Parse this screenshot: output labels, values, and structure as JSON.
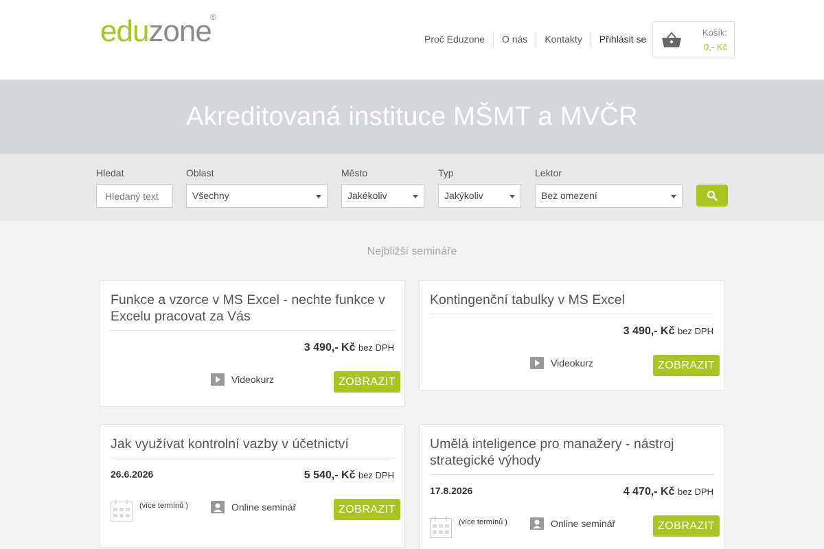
{
  "header": {
    "logo_part1": "edu",
    "logo_part2": "zone",
    "logo_reg": "®",
    "nav": [
      "Proč Eduzone",
      "O nás",
      "Kontakty",
      "Přihlásit se"
    ],
    "cart_label": "Košík:",
    "cart_price": "0,- Kč",
    "cart_icon": "basket-icon"
  },
  "banner": {
    "title": "Akreditovaná instituce MŠMT a MVČR"
  },
  "search": {
    "hledat_label": "Hledat",
    "hledat_placeholder": "Hledaný text",
    "oblast_label": "Oblast",
    "oblast_value": "Všechny",
    "mesto_label": "Město",
    "mesto_value": "Jakékoliv",
    "typ_label": "Typ",
    "typ_value": "Jakýkoliv",
    "lektor_label": "Lektor",
    "lektor_value": "Bez omezení",
    "button_icon": "search-icon"
  },
  "section_title": "Nejbližší semináře",
  "cards": [
    {
      "title": "Funkce a vzorce v MS Excel - nechte funkce v Excelu pracovat za Vás",
      "price": "3 490,- Kč",
      "vat": "bez DPH",
      "type": "Videokurz",
      "button": "ZOBRAZIT"
    },
    {
      "title": "Kontingenční tabulky v MS Excel",
      "price": "3 490,- Kč",
      "vat": "bez DPH",
      "type": "Videokurz",
      "button": "ZOBRAZIT"
    },
    {
      "title": "Jak využívat kontrolní vazby v účetnictví",
      "date": "26.6.2026",
      "more": "(více termínů )",
      "price": "5 540,- Kč",
      "vat": "bez DPH",
      "type": "Online seminář",
      "button": "ZOBRAZIT"
    },
    {
      "title": "Umělá inteligence pro manažery - nástroj strategické výhody",
      "date": "17.8.2026",
      "more": "(více termínů )",
      "price": "4 470,- Kč",
      "vat": "bez DPH",
      "type": "Online seminář",
      "button": "ZOBRAZIT"
    }
  ],
  "colors": {
    "accent": "#a8c520",
    "banner": "#d3d6da",
    "search_bg": "#e6e8ea",
    "page_bg": "#f2f2f2"
  }
}
